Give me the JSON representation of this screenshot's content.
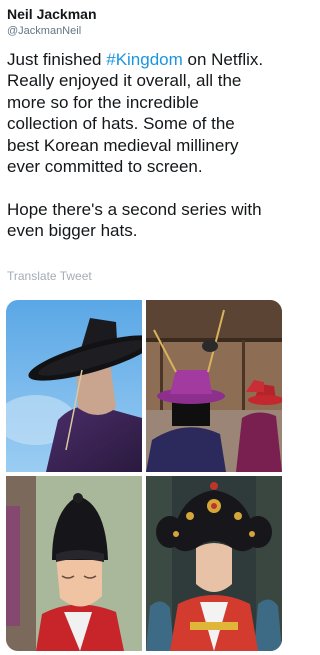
{
  "author": {
    "display_name": "Neil Jackman",
    "handle": "@JackmanNeil"
  },
  "tweet": {
    "lines": [
      {
        "pre": "Just finished ",
        "hashtag": "#Kingdom",
        "post": " on Netflix."
      },
      {
        "text": "Really enjoyed it overall, all the"
      },
      {
        "text": "more so for the incredible"
      },
      {
        "text": "collection of hats. Some of the"
      },
      {
        "text": "best Korean medieval millinery"
      },
      {
        "text": "ever committed to screen."
      },
      {
        "text": "Hope there's a second series with"
      },
      {
        "text": "even bigger hats."
      }
    ]
  },
  "translate_label": "Translate Tweet",
  "media": [
    {
      "icon": "photo-man-in-black-gat-hat"
    },
    {
      "icon": "photo-officials-in-purple-and-red-hats"
    },
    {
      "icon": "photo-boy-in-black-hat"
    },
    {
      "icon": "photo-queen-with-ornate-headdress"
    }
  ],
  "colors": {
    "text": "#14171a",
    "handle": "#657786",
    "hashtag": "#1b95e0",
    "translate": "#a3adb7"
  }
}
